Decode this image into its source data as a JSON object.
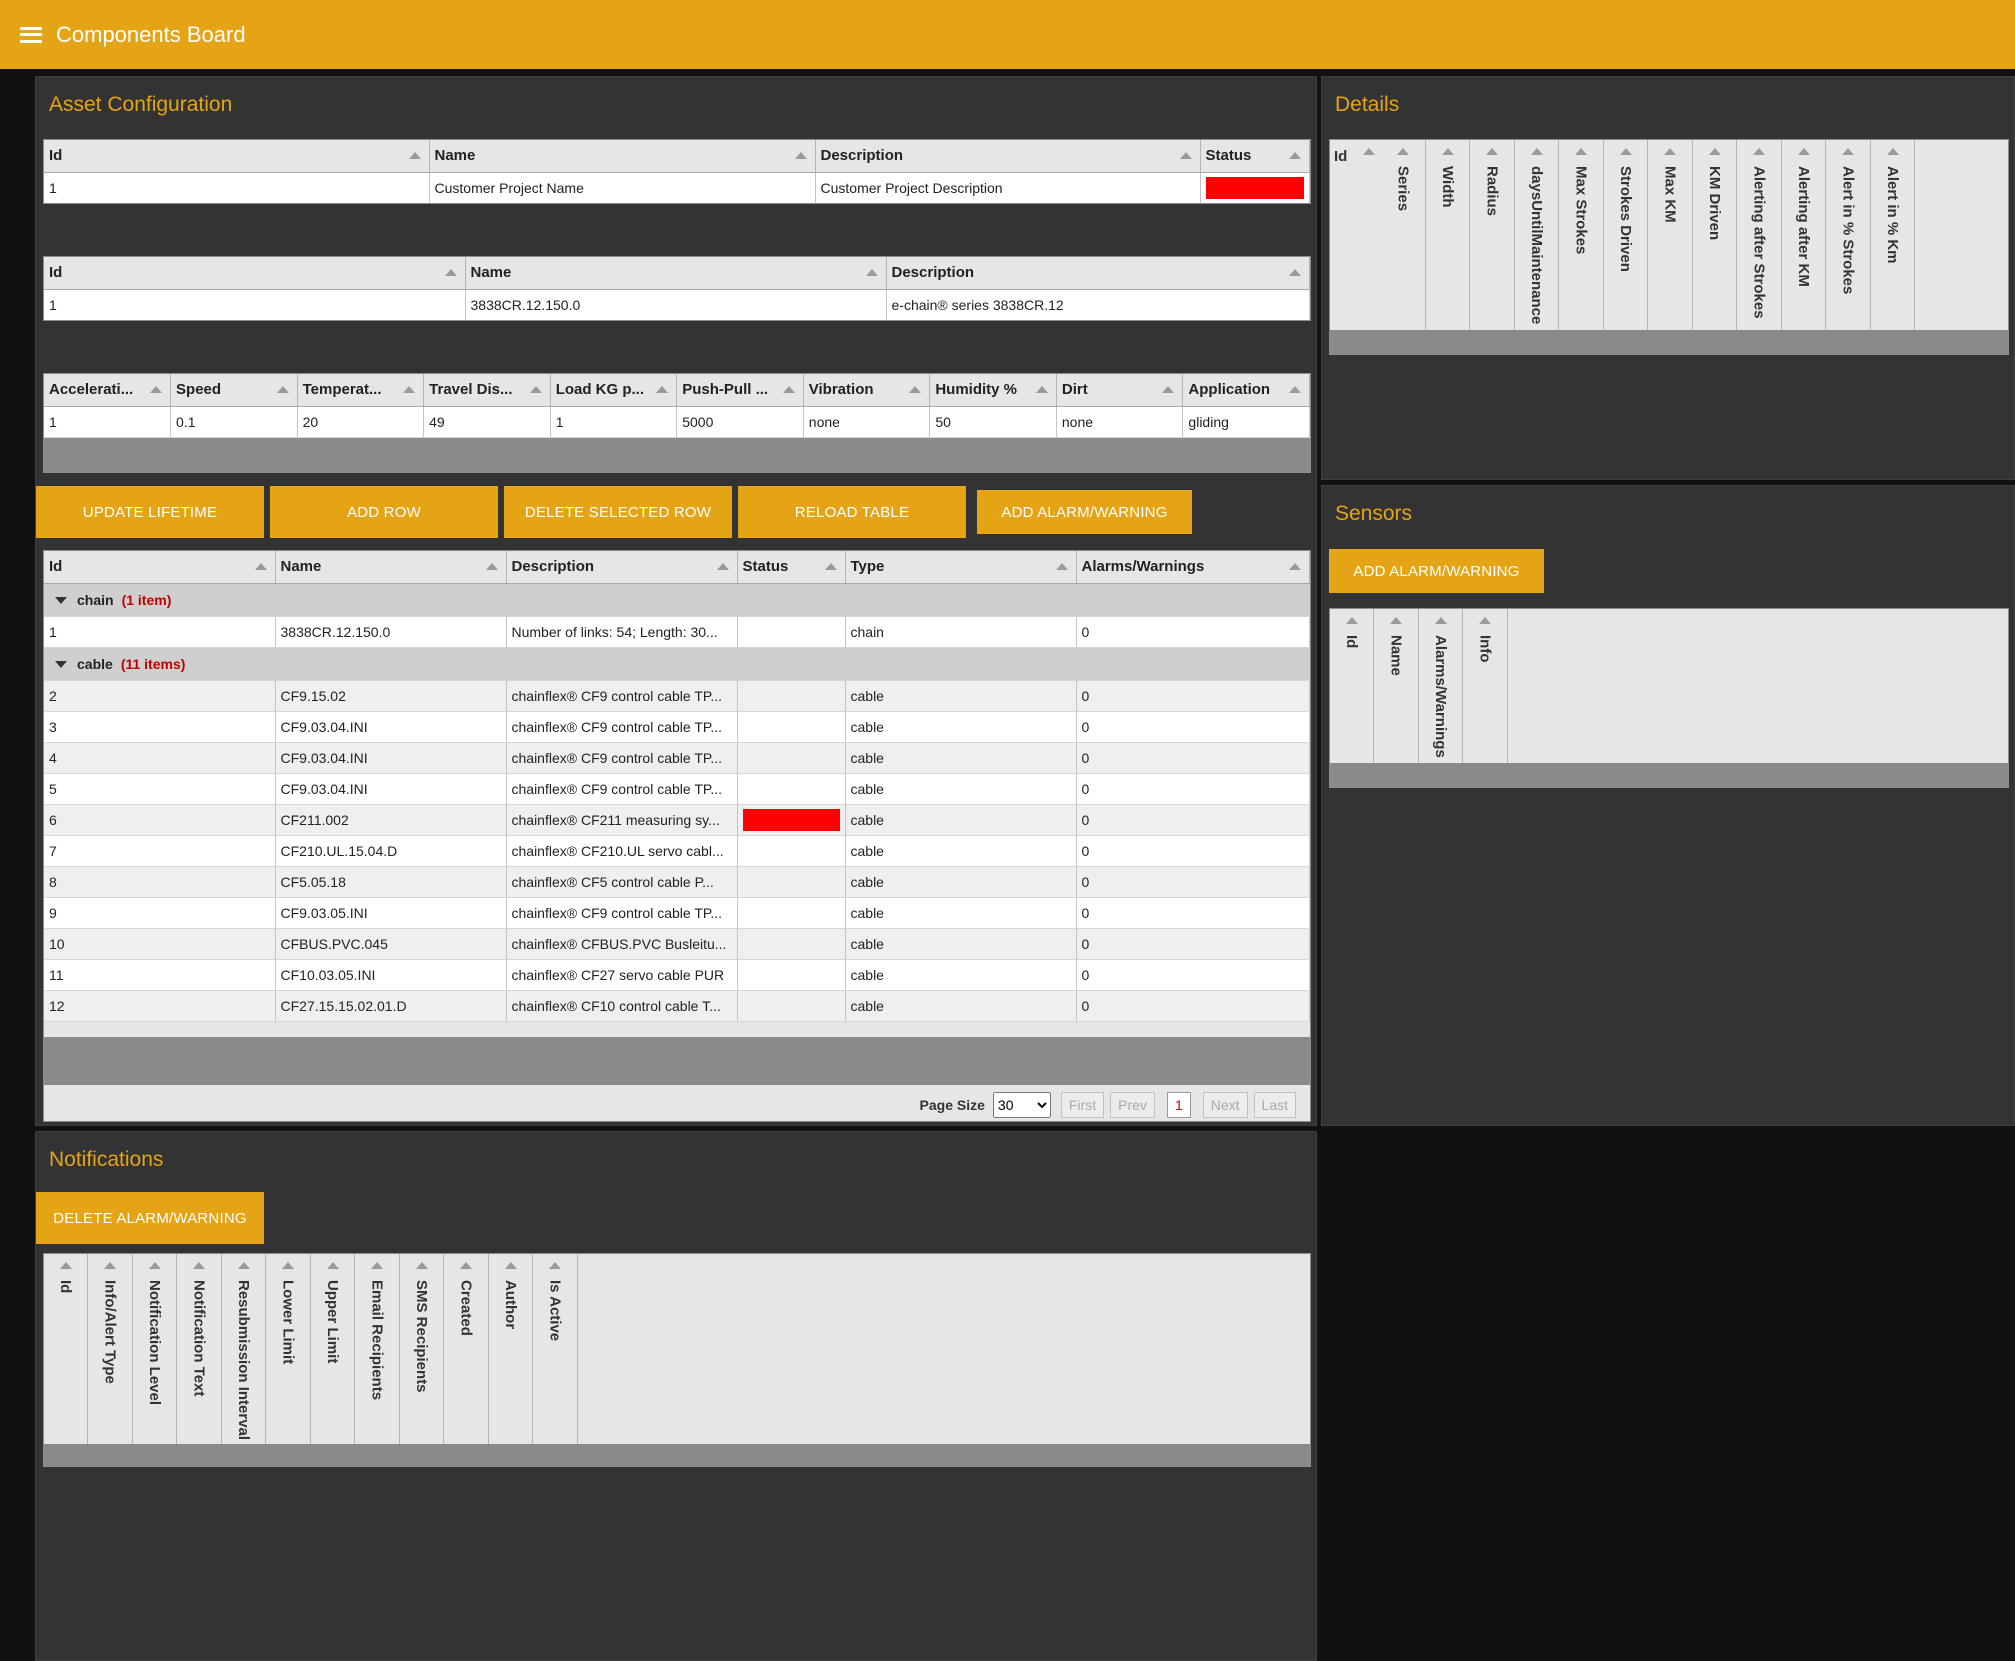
{
  "app": {
    "title": "Components Board"
  },
  "colors": {
    "accent": "#e5a416",
    "status_red": "#ff0000",
    "panel_bg": "#333333",
    "page_bg": "#111111",
    "group_count": "#c00000"
  },
  "asset": {
    "title": "Asset Configuration",
    "project_table": {
      "headers": [
        "Id",
        "Name",
        "Description",
        "Status"
      ],
      "row": {
        "id": "1",
        "name": "Customer Project Name",
        "description": "Customer Project Description",
        "status_color": "#ff0000"
      }
    },
    "series_table": {
      "headers": [
        "Id",
        "Name",
        "Description"
      ],
      "row": {
        "id": "1",
        "name": "3838CR.12.150.0",
        "description": "e-chain® series 3838CR.12"
      }
    },
    "conditions_table": {
      "headers": [
        "Accelerati...",
        "Speed",
        "Temperat...",
        "Travel Dis...",
        "Load KG p...",
        "Push-Pull ...",
        "Vibration",
        "Humidity %",
        "Dirt",
        "Application"
      ],
      "row": [
        "1",
        "0.1",
        "20",
        "49",
        "1",
        "5000",
        "none",
        "50",
        "none",
        "gliding"
      ]
    },
    "buttons": {
      "update_lifetime": "UPDATE LIFETIME",
      "add_row": "ADD ROW",
      "delete_selected_row": "DELETE SELECTED ROW",
      "reload_table": "RELOAD TABLE",
      "add_alarm": "ADD ALARM/WARNING"
    },
    "components_table": {
      "headers": [
        "Id",
        "Name",
        "Description",
        "Status",
        "Type",
        "Alarms/Warnings"
      ],
      "groups": [
        {
          "name": "chain",
          "count": "(1 item)"
        },
        {
          "name": "cable",
          "count": "(11 items)"
        }
      ],
      "chain_rows": [
        [
          "1",
          "3838CR.12.150.0",
          "Number of links: 54; Length: 30...",
          "",
          "chain",
          "0"
        ]
      ],
      "cable_rows": [
        [
          "2",
          "CF9.15.02",
          "chainflex® CF9 control cable TP...",
          "",
          "cable",
          "0"
        ],
        [
          "3",
          "CF9.03.04.INI",
          "chainflex® CF9 control cable TP...",
          "",
          "cable",
          "0"
        ],
        [
          "4",
          "CF9.03.04.INI",
          "chainflex® CF9 control cable TP...",
          "",
          "cable",
          "0"
        ],
        [
          "5",
          "CF9.03.04.INI",
          "chainflex® CF9 control cable TP...",
          "",
          "cable",
          "0"
        ],
        [
          "6",
          "CF211.002",
          "chainflex® CF211 measuring sy...",
          "red",
          "cable",
          "0"
        ],
        [
          "7",
          "CF210.UL.15.04.D",
          "chainflex® CF210.UL servo cabl...",
          "",
          "cable",
          "0"
        ],
        [
          "8",
          "CF5.05.18",
          "chainflex® CF5 control cable P...",
          "",
          "cable",
          "0"
        ],
        [
          "9",
          "CF9.03.05.INI",
          "chainflex® CF9 control cable TP...",
          "",
          "cable",
          "0"
        ],
        [
          "10",
          "CFBUS.PVC.045",
          "chainflex® CFBUS.PVC Busleitu...",
          "",
          "cable",
          "0"
        ],
        [
          "11",
          "CF10.03.05.INI",
          "chainflex® CF27 servo cable PUR",
          "",
          "cable",
          "0"
        ],
        [
          "12",
          "CF27.15.15.02.01.D",
          "chainflex® CF10 control cable T...",
          "",
          "cable",
          "0"
        ]
      ]
    },
    "pager": {
      "page_size_label": "Page Size",
      "page_size": "30",
      "first": "First",
      "prev": "Prev",
      "current": "1",
      "next": "Next",
      "last": "Last"
    }
  },
  "details": {
    "title": "Details",
    "columns": [
      "Series",
      "Width",
      "Radius",
      "daysUntilMaintenance",
      "Max Strokes",
      "Strokes Driven",
      "Max KM",
      "KM Driven",
      "Alerting after Strokes",
      "Alerting after KM",
      "Alert in % Strokes",
      "Alert in % Km"
    ],
    "id_label": "Id"
  },
  "sensors": {
    "title": "Sensors",
    "add_button": "ADD ALARM/WARNING",
    "columns": [
      "Id",
      "Name",
      "Alarms/Warnings",
      "Info"
    ]
  },
  "notifications": {
    "title": "Notifications",
    "delete_button": "DELETE ALARM/WARNING",
    "columns": [
      "Id",
      "Info/Alert Type",
      "Notification Level",
      "Notification Text",
      "Resubmission Interval",
      "Lower Limit",
      "Upper Limit",
      "Email Recipients",
      "SMS Recipients",
      "Created",
      "Author",
      "Is Active"
    ]
  }
}
